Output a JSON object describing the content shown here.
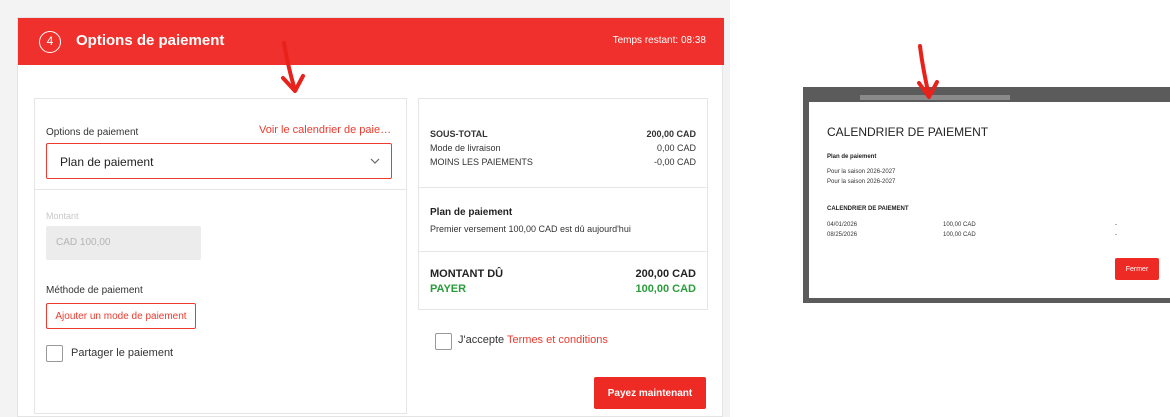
{
  "header": {
    "step": "4",
    "title": "Options de paiement",
    "timer_label": "Temps restant:",
    "timer_value": "08:38"
  },
  "payment_options": {
    "label": "Options de paiement",
    "calendar_link": "Voir le calendrier de paiement",
    "selected": "Plan de paiement",
    "amount_label": "Montant",
    "amount_value": "CAD 100,00",
    "method_label": "Méthode de paiement",
    "add_method_button": "Ajouter un mode de paiement",
    "split_label": "Partager le paiement"
  },
  "summary": {
    "rows": [
      {
        "label": "SOUS-TOTAL",
        "value": "200,00 CAD"
      },
      {
        "label": "Mode de livraison",
        "value": "0,00 CAD"
      },
      {
        "label": "MOINS LES PAIEMENTS",
        "value": "-0,00 CAD"
      }
    ],
    "plan_title": "Plan de paiement",
    "plan_desc": "Premier versement 100,00 CAD est dû aujourd'hui",
    "due_label": "MONTANT DÛ",
    "due_value": "200,00 CAD",
    "pay_label": "PAYER",
    "pay_value": "100,00 CAD"
  },
  "terms": {
    "accept_label": "J'accepte",
    "link": "Termes et conditions"
  },
  "pay_now_button": "Payez maintenant",
  "modal": {
    "title": "CALENDRIER DE PAIEMENT",
    "plan_label": "Plan de paiement",
    "seasons": [
      "Pour la saison 2026-2027",
      "Pour la saison 2026-2027"
    ],
    "schedule_label": "CALENDRIER DE PAIEMENT",
    "schedule": [
      {
        "date": "04/01/2026",
        "amount": "100,00 CAD",
        "status": "-"
      },
      {
        "date": "08/25/2026",
        "amount": "100,00 CAD",
        "status": "-"
      }
    ],
    "close_button": "Fermer"
  },
  "colors": {
    "brand_red": "#f0302c",
    "pay_green": "#2a9d3b",
    "annotation_arrow": "#e8221b"
  }
}
